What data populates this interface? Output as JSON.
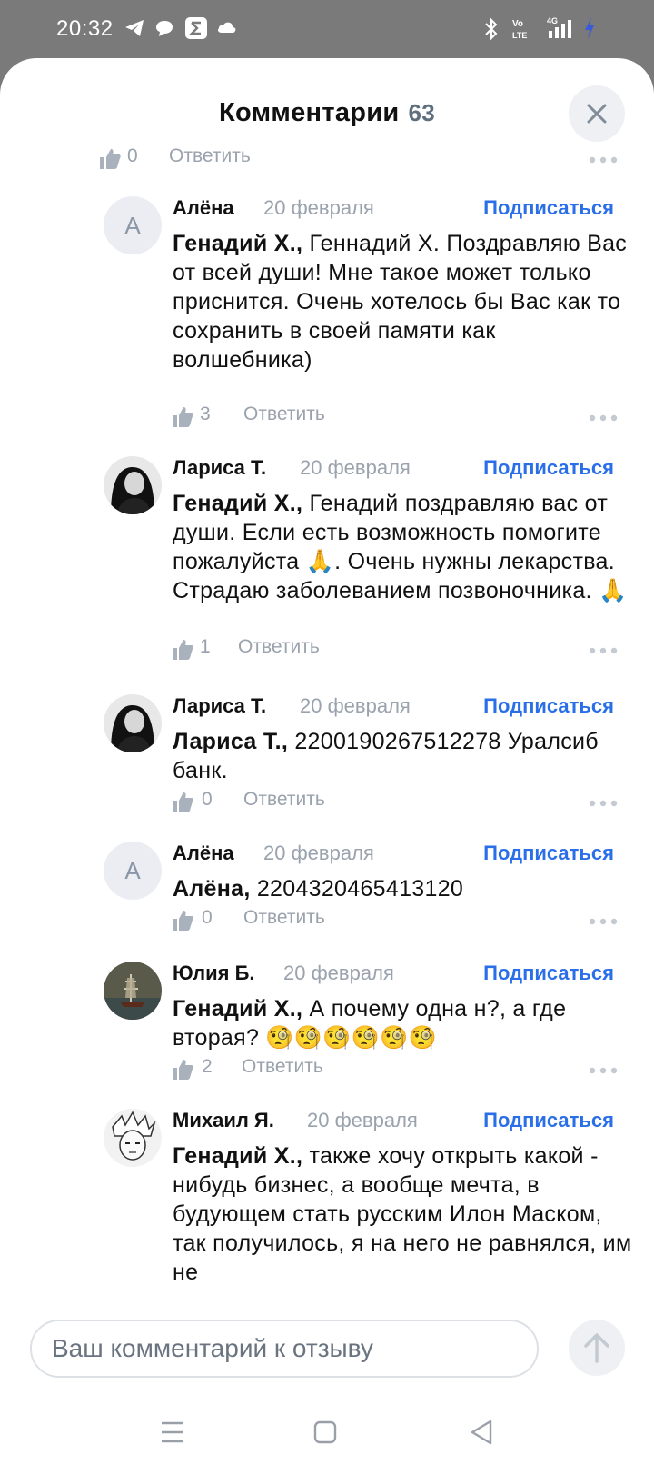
{
  "status_bar": {
    "time": "20:32"
  },
  "header": {
    "title": "Комментарии",
    "count": "63"
  },
  "top_action": {
    "likes": "0",
    "reply": "Ответить"
  },
  "comments": [
    {
      "author": "Алёна",
      "date": "20 февраля",
      "subscribe": "Подписаться",
      "avatar_letter": "А",
      "mention": "Генадий Х.,",
      "text": " Геннадий Х. Поздравляю Вас от всей души! Мне такое может только приснится. Очень хотелось бы Вас как то сохранить в своей памяти как волшебника)",
      "likes": "3",
      "reply": "Ответить"
    },
    {
      "author": "Лариса Т.",
      "date": "20 февраля",
      "subscribe": "Подписаться",
      "mention": "Генадий Х.,",
      "text": " Генадий поздравляю вас от души. Если есть возможность помогите пожалуйста 🙏. Очень нужны лекарства. Страдаю заболеванием позвоночника. 🙏",
      "likes": "1",
      "reply": "Ответить"
    },
    {
      "author": "Лариса Т.",
      "date": "20 февраля",
      "subscribe": "Подписаться",
      "mention": "Лариса Т.,",
      "text": " 2200190267512278 Уралсиб банк.",
      "likes": "0",
      "reply": "Ответить"
    },
    {
      "author": "Алёна",
      "date": "20 февраля",
      "subscribe": "Подписаться",
      "avatar_letter": "А",
      "mention": "Алёна,",
      "text": " 2204320465413120",
      "likes": "0",
      "reply": "Ответить"
    },
    {
      "author": "Юлия Б.",
      "date": "20 февраля",
      "subscribe": "Подписаться",
      "mention": "Генадий Х.,",
      "text": " А почему одна н?, а где вторая? 🧐🧐🧐🧐🧐🧐",
      "likes": "2",
      "reply": "Ответить"
    },
    {
      "author": "Михаил Я.",
      "date": "20 февраля",
      "subscribe": "Подписаться",
      "mention": "Генадий Х.,",
      "text": " также хочу открыть какой - нибудь бизнес, а вообще мечта, в будующем стать русским Илон Маском, так получилось, я на него не равнялся, им не"
    }
  ],
  "input": {
    "placeholder": "Ваш комментарий к отзыву"
  },
  "colors": {
    "accent": "#2a6fe8",
    "muted": "#99a2ad"
  }
}
